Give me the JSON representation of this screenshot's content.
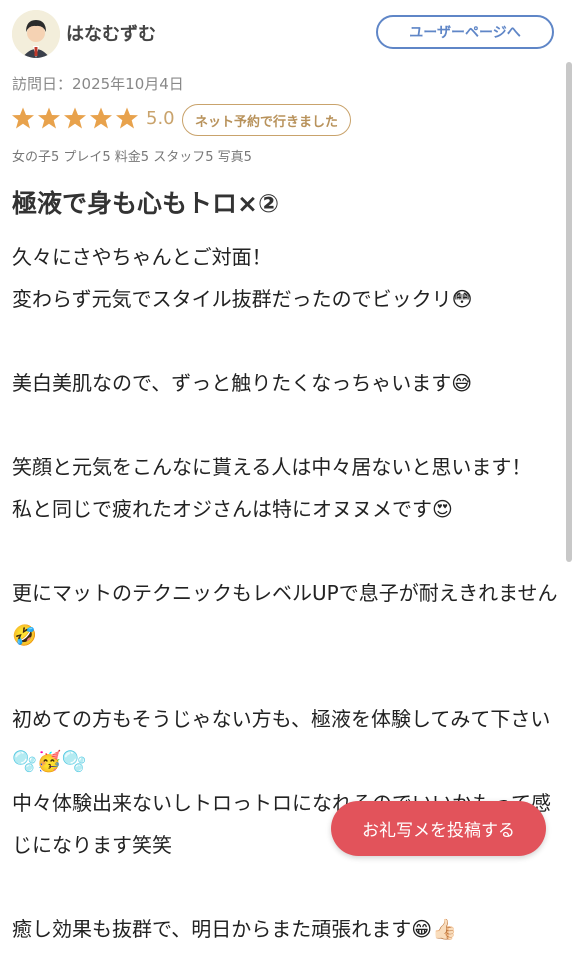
{
  "user": {
    "name": "はなむずむ",
    "page_button": "ユーザーページへ"
  },
  "visit_date": "訪問日：2025年10月4日",
  "rating": {
    "value": "5.0",
    "stars": 5,
    "badge": "ネット予約で行きました"
  },
  "sub_ratings": "女の子5 プレイ5 料金5 スタッフ5 写真5",
  "review": {
    "title": "極液で身も心もトロ×②",
    "body": "久々にさやちゃんとご対面！\n変わらず元気でスタイル抜群だったのでビックリ😳\n\n美白美肌なので、ずっと触りたくなっちゃいます😅\n\n笑顔と元気をこんなに貰える人は中々居ないと思います！\n私と同じで疲れたオジさんは特にオヌヌメです😍\n\n更にマットのテクニックもレベルUPで息子が耐えきれません🤣\n\n初めての方もそうじゃない方も、極液を体験してみて下さい🫧🥳🫧\n中々体験出来ないしトロっトロになれるのでいいかもって感じになります笑笑\n\n癒し効果も抜群で、明日からまた頑張れます😁👍🏻"
  },
  "post_button": "お礼写メを投稿する",
  "colors": {
    "accent_blue": "#5f86c7",
    "star_orange": "#e8a24c",
    "badge_gold": "#c9a36c",
    "post_red": "#e2535b"
  }
}
